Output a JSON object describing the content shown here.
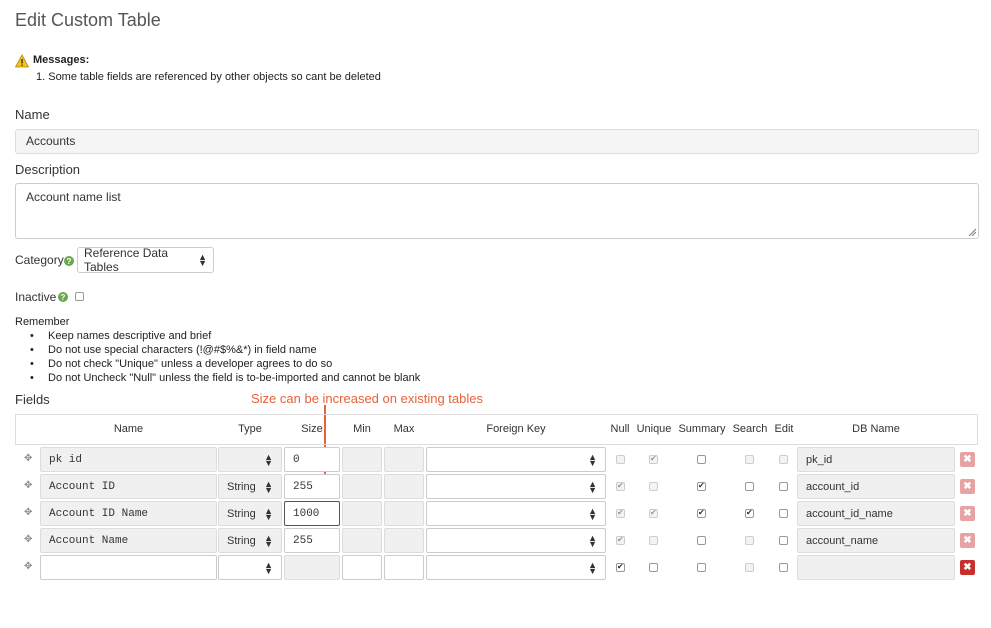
{
  "page_title": "Edit Custom Table",
  "messages": {
    "title": "Messages:",
    "items": [
      "1. Some table fields are referenced by other objects so cant be deleted"
    ]
  },
  "form": {
    "name_label": "Name",
    "name_value": "Accounts",
    "description_label": "Description",
    "description_value": "Account name list",
    "category_label": "Category",
    "category_value": "Reference Data Tables",
    "inactive_label": "Inactive",
    "inactive_checked": false
  },
  "remember": {
    "title": "Remember",
    "items": [
      "Keep names descriptive and brief",
      "Do not use special characters (!@#$%&*) in field name",
      "Do not check \"Unique\" unless a developer agrees to do so",
      "Do not Uncheck \"Null\" unless the field is to-be-imported and cannot be blank"
    ]
  },
  "fields_label": "Fields",
  "annotation": "Size can be increased on existing tables",
  "columns": [
    "Name",
    "Type",
    "Size",
    "Min",
    "Max",
    "Foreign Key",
    "Null",
    "Unique",
    "Summary",
    "Search",
    "Edit",
    "DB Name"
  ],
  "rows": [
    {
      "name": "pk id",
      "type": "",
      "size": "0",
      "min": "",
      "max": "",
      "fk": "",
      "null": false,
      "unique": true,
      "summary": false,
      "search": false,
      "edit": false,
      "db_name": "pk_id"
    },
    {
      "name": "Account ID",
      "type": "String",
      "size": "255",
      "min": "",
      "max": "",
      "fk": "",
      "null": true,
      "unique": false,
      "summary": true,
      "search": false,
      "edit": false,
      "db_name": "account_id"
    },
    {
      "name": "Account ID Name",
      "type": "String",
      "size": "1000",
      "min": "",
      "max": "",
      "fk": "",
      "null": true,
      "unique": true,
      "summary": true,
      "search": true,
      "edit": false,
      "db_name": "account_id_name"
    },
    {
      "name": "Account Name",
      "type": "String",
      "size": "255",
      "min": "",
      "max": "",
      "fk": "",
      "null": true,
      "unique": false,
      "summary": false,
      "search": false,
      "edit": false,
      "db_name": "account_name"
    },
    {
      "name": "",
      "type": "",
      "size": "",
      "min": "",
      "max": "",
      "fk": "",
      "null": true,
      "unique": false,
      "summary": false,
      "search": false,
      "edit": false,
      "db_name": ""
    }
  ],
  "colors": {
    "accent_orange": "#e8623a",
    "delete_light": "#e7a3a3",
    "delete_dark": "#c9302c",
    "help_green": "#6aa84f"
  }
}
